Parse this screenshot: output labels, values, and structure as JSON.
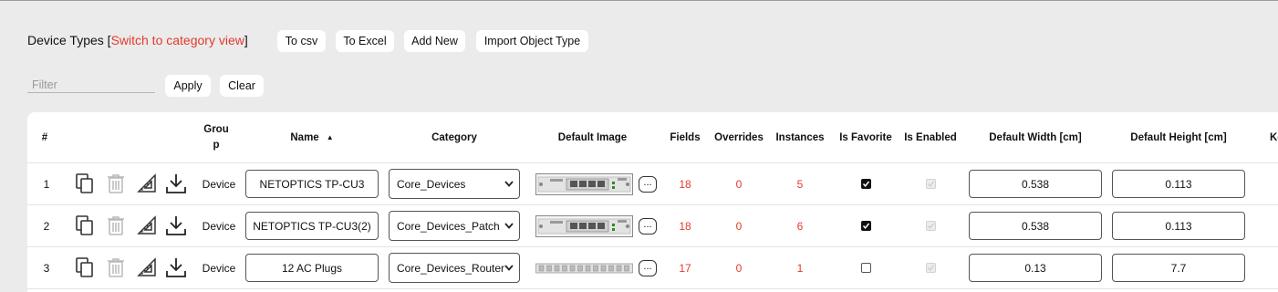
{
  "header": {
    "title_prefix": "Device Types [",
    "switch_link": "Switch to category view",
    "title_suffix": "]",
    "buttons": {
      "csv": "To csv",
      "excel": "To Excel",
      "add_new": "Add New",
      "import": "Import Object Type"
    }
  },
  "filter": {
    "placeholder": "Filter",
    "value": "",
    "apply": "Apply",
    "clear": "Clear"
  },
  "table": {
    "columns": {
      "num": "#",
      "group_line1": "Grou",
      "group_line2": "p",
      "name": "Name",
      "sort_arrow": "▲",
      "category": "Category",
      "default_image": "Default Image",
      "fields": "Fields",
      "overrides": "Overrides",
      "instances": "Instances",
      "is_favorite": "Is Favorite",
      "is_enabled": "Is Enabled",
      "default_width": "Default Width [cm]",
      "default_height": "Default Height [cm]",
      "next_col": "Ke"
    },
    "rows": [
      {
        "num": "1",
        "group": "Device",
        "name": "NETOPTICS TP-CU3",
        "category": "Core_Devices",
        "image": "panel",
        "fields": "18",
        "overrides": "0",
        "instances": "5",
        "is_favorite": true,
        "is_enabled": true,
        "width": "0.538",
        "height": "0.113"
      },
      {
        "num": "2",
        "group": "Device",
        "name": "NETOPTICS TP-CU3(2)",
        "category": "Core_Devices_Patch",
        "image": "panel",
        "fields": "18",
        "overrides": "0",
        "instances": "6",
        "is_favorite": true,
        "is_enabled": true,
        "width": "0.538",
        "height": "0.113"
      },
      {
        "num": "3",
        "group": "Device",
        "name": "12 AC Plugs",
        "category": "Core_Devices_Router",
        "image": "strip",
        "fields": "17",
        "overrides": "0",
        "instances": "1",
        "is_favorite": false,
        "is_enabled": true,
        "width": "0.13",
        "height": "7.7"
      }
    ],
    "image_more_label": "...",
    "icons": [
      "copy-icon",
      "trash-icon",
      "ruler-triangle-icon",
      "download-icon"
    ]
  },
  "colors": {
    "accent": "#e23a2e",
    "background": "#ebebeb",
    "panel": "#ffffff"
  }
}
